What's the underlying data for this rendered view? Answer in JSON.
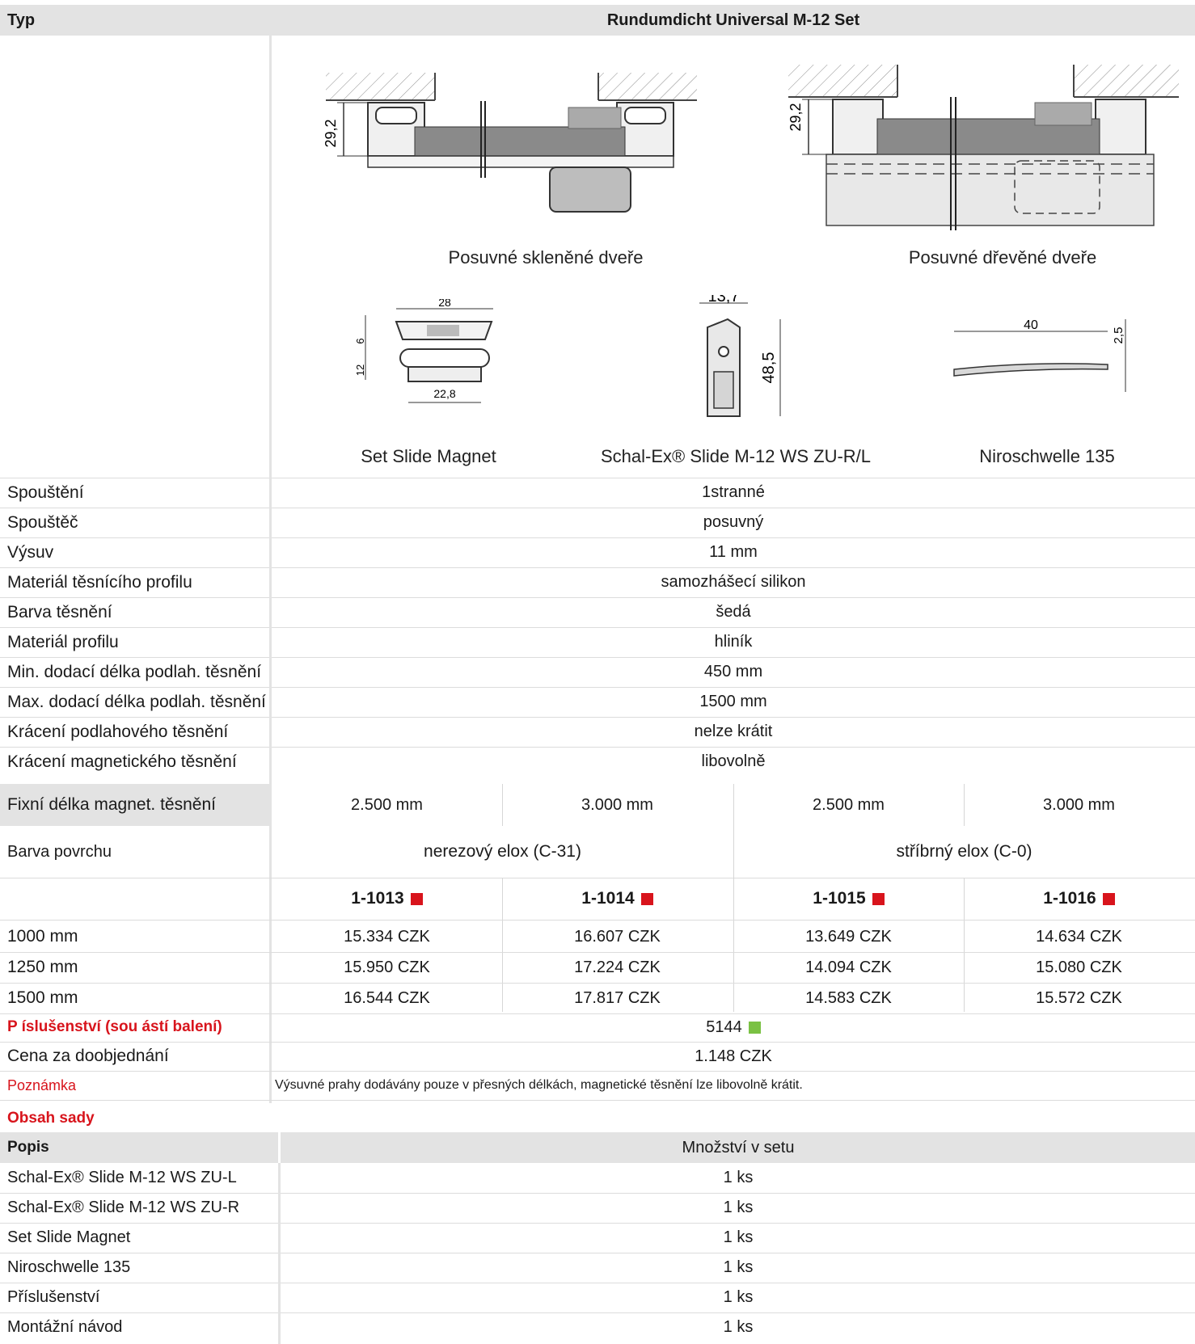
{
  "header": {
    "col1": "Typ",
    "col2": "Rundumdicht Universal M-12 Set"
  },
  "images": {
    "cap_glass": "Posuvné skleněné dveře",
    "cap_wood": "Posuvné dřevěné dveře",
    "cap_magnet": "Set Slide Magnet",
    "cap_schalex": "Schal-Ex® Slide  M-12 WS ZU-R/L",
    "cap_niro": "Niroschwelle 135",
    "dim_29_a": "29,2",
    "dim_29_b": "29,2",
    "dim_28": "28",
    "dim_6": "6",
    "dim_12": "12",
    "dim_228": "22,8",
    "dim_137": "13,7",
    "dim_485": "48,5",
    "dim_40": "40",
    "dim_25": "2,5"
  },
  "specs": [
    {
      "label": "Spouštění",
      "value": "1stranné"
    },
    {
      "label": "Spouštěč",
      "value": "posuvný"
    },
    {
      "label": "Výsuv",
      "value": "11 mm"
    },
    {
      "label": "Materiál těsnícího profilu",
      "value": "samozhášecí silikon"
    },
    {
      "label": "Barva těsnění",
      "value": "šedá"
    },
    {
      "label": "Materiál profilu",
      "value": "hliník"
    },
    {
      "label": "Min. dodací délka podlah. těsnění",
      "value": "450 mm"
    },
    {
      "label": "Max. dodací délka podlah. těsnění",
      "value": "1500 mm"
    },
    {
      "label": "Krácení podlahového těsnění",
      "value": "nelze krátit"
    },
    {
      "label": "Krácení magnetického těsnění",
      "value": "libovolně"
    }
  ],
  "fixed": {
    "label": "Fixní délka magnet. těsnění",
    "values": [
      "2.500 mm",
      "3.000 mm",
      "2.500 mm",
      "3.000 mm"
    ]
  },
  "surface": {
    "label": "Barva povrchu",
    "values": [
      "nerezový elox (C-31)",
      "stříbrný elox (C-0)"
    ]
  },
  "articles": [
    "1-1013",
    "1-1014",
    "1-1015",
    "1-1016"
  ],
  "prices": [
    {
      "label": "1000 mm",
      "values": [
        "15.334 CZK",
        "16.607 CZK",
        "13.649 CZK",
        "14.634 CZK"
      ]
    },
    {
      "label": "1250 mm",
      "values": [
        "15.950 CZK",
        "17.224 CZK",
        "14.094 CZK",
        "15.080 CZK"
      ]
    },
    {
      "label": "1500 mm",
      "values": [
        "16.544 CZK",
        "17.817 CZK",
        "14.583 CZK",
        "15.572 CZK"
      ]
    }
  ],
  "accessory": {
    "label": "P íslušenství (sou ástí balení)",
    "value": "5144"
  },
  "reorder": {
    "label": "Cena za doobjednání",
    "value": "1.148 CZK"
  },
  "note": {
    "label": "Poznámka",
    "value": "Výsuvné prahy dodávány pouze v přesných délkách, magnetické těsnění lze libovolně krátit."
  },
  "set": {
    "title": "Obsah sady",
    "col1": "Popis",
    "col2": "Množství v setu",
    "rows": [
      {
        "label": "Schal-Ex® Slide  M-12 WS ZU-L",
        "value": "1 ks"
      },
      {
        "label": "Schal-Ex® Slide  M-12 WS ZU-R",
        "value": "1 ks"
      },
      {
        "label": "Set Slide Magnet",
        "value": "1 ks"
      },
      {
        "label": "Niroschwelle 135",
        "value": "1 ks"
      },
      {
        "label": "Příslušenství",
        "value": "1 ks"
      },
      {
        "label": "Montážní návod",
        "value": "1 ks"
      }
    ]
  },
  "colors": {
    "header_bg": "#e3e3e3",
    "accent_red": "#d8141c",
    "accent_green": "#7ac143"
  }
}
